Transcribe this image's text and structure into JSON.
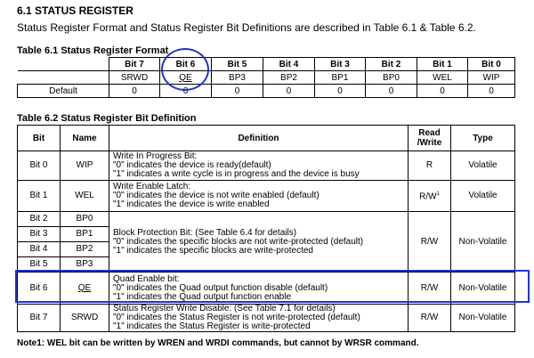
{
  "heading": "6.1 STATUS REGISTER",
  "intro": "Status Register Format and Status Register Bit Definitions are described in Table 6.1 & Table 6.2.",
  "table1": {
    "caption": "Table 6.1 Status Register Format",
    "headers": [
      "Bit 7",
      "Bit 6",
      "Bit 5",
      "Bit 4",
      "Bit 3",
      "Bit 2",
      "Bit 1",
      "Bit 0"
    ],
    "names": [
      "SRWD",
      "QE",
      "BP3",
      "BP2",
      "BP1",
      "BP0",
      "WEL",
      "WIP"
    ],
    "default_label": "Default",
    "defaults": [
      "0",
      "0",
      "0",
      "0",
      "0",
      "0",
      "0",
      "0"
    ]
  },
  "table2": {
    "caption": "Table 6.2 Status Register Bit Definition",
    "headers": {
      "bit": "Bit",
      "name": "Name",
      "definition": "Definition",
      "rw_line1": "Read",
      "rw_line2": "/Write",
      "type": "Type"
    },
    "rows": [
      {
        "bit": "Bit 0",
        "name": "WIP",
        "def": [
          "Write In Progress Bit:",
          "\"0\" indicates the device is ready(default)",
          "\"1\" indicates a write cycle is in progress and the device is busy"
        ],
        "rw": "R",
        "type": "Volatile"
      },
      {
        "bit": "Bit 1",
        "name": "WEL",
        "def": [
          "Write Enable Latch:",
          "\"0\" indicates the device is not write enabled (default)",
          "\"1\" indicates the device is write enabled"
        ],
        "rw": "R/W",
        "rw_sup": "1",
        "type": "Volatile"
      },
      {
        "bit": "Bit 2",
        "name": "BP0"
      },
      {
        "bit": "Bit 3",
        "name": "BP1"
      },
      {
        "bit": "Bit 4",
        "name": "BP2"
      },
      {
        "bit": "Bit 5",
        "name": "BP3"
      },
      {
        "bit": "Bit 6",
        "name": "QE",
        "def": [
          "Quad Enable bit:",
          "\"0\" indicates the Quad output function disable (default)",
          "\"1\" indicates the Quad output function enable"
        ],
        "rw": "R/W",
        "type": "Non-Volatile"
      },
      {
        "bit": "Bit 7",
        "name": "SRWD",
        "def": [
          "Status Register Write Disable: (See Table 7.1 for details)",
          "\"0\" indicates the Status Register is not write-protected (default)",
          "\"1\" indicates the Status Register is write-protected"
        ],
        "rw": "R/W",
        "type": "Non-Volatile"
      }
    ],
    "bp_group": {
      "def": [
        "Block Protection Bit: (See Table 6.4 for details)",
        "\"0\" indicates the specific blocks are not write-protected (default)",
        "\"1\" indicates the specific blocks are write-protected"
      ],
      "rw": "R/W",
      "type": "Non-Volatile"
    }
  },
  "note": "Note1: WEL bit can be written by WREN and WRDI commands, but cannot by WRSR command.",
  "highlight_color": "#2233cc"
}
